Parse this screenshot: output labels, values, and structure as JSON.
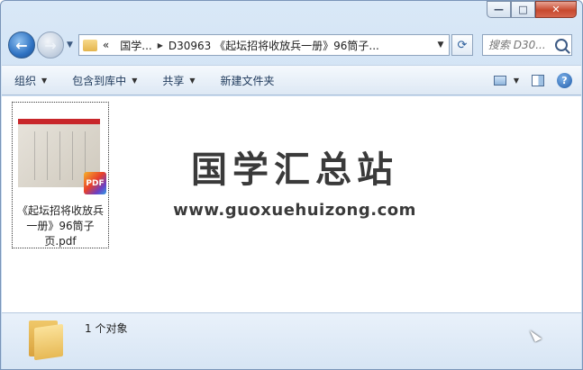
{
  "window": {
    "caption_buttons": {
      "minimize": "—",
      "maximize": "□",
      "close": "✕"
    }
  },
  "nav": {
    "back_icon": "back-arrow-icon",
    "forward_icon": "forward-arrow-icon",
    "breadcrumb": [
      "«",
      "国学...",
      "D30963 《起坛招将收放兵一册》96筒子..."
    ],
    "search_placeholder": "搜索 D30..."
  },
  "toolbar": {
    "organize": "组织",
    "include_in_library": "包含到库中",
    "share": "共享",
    "new_folder": "新建文件夹"
  },
  "file": {
    "badge": "PDF",
    "name": "《起坛招将收放兵一册》96筒子页.pdf"
  },
  "watermark": {
    "title": "国学汇总站",
    "url": "www.guoxuehuizong.com"
  },
  "status": {
    "count": "1 个对象"
  }
}
